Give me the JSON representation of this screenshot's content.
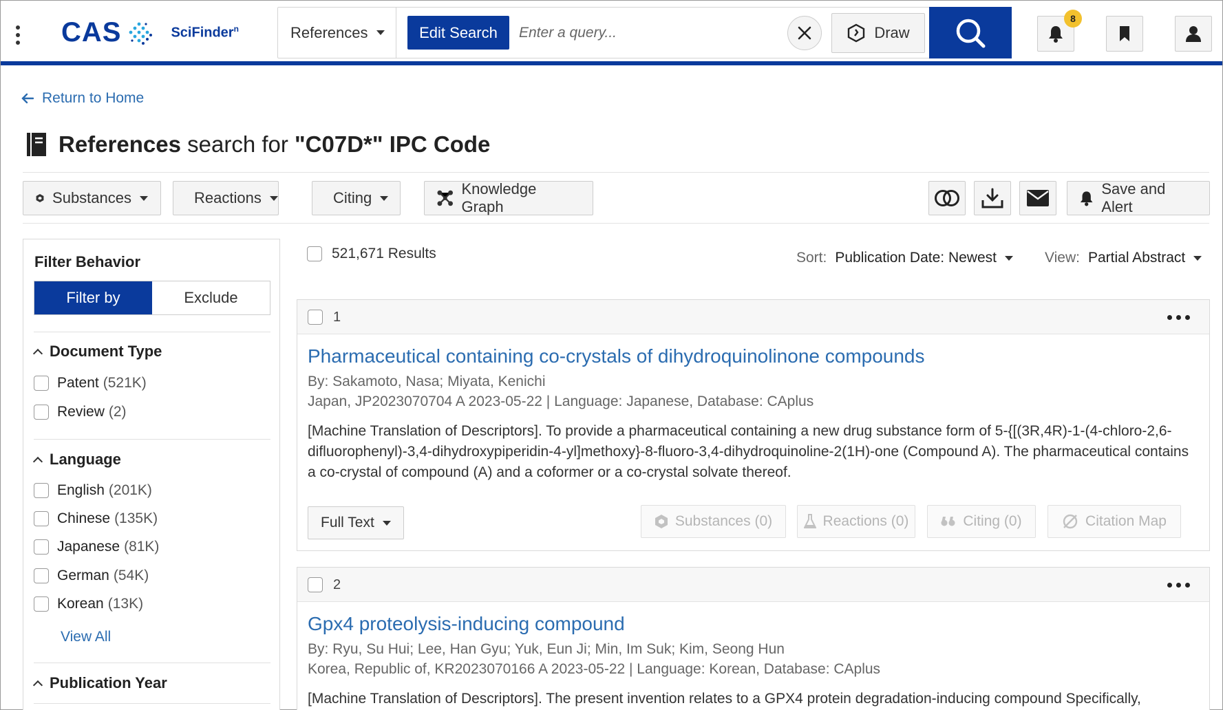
{
  "header": {
    "logo_text": "CAS",
    "product_name": "SciFinder",
    "product_sup": "n",
    "search_type": "References",
    "edit_search_label": "Edit Search",
    "query_placeholder": "Enter a query...",
    "draw_label": "Draw",
    "notification_count": "8",
    "brand_color": "#0a3a9c"
  },
  "nav": {
    "return_label": "Return to Home"
  },
  "page": {
    "title_bold": "References",
    "title_mid": " search for ",
    "title_query": "\"C07D*\" IPC Code"
  },
  "toolbar": {
    "substances": "Substances",
    "reactions": "Reactions",
    "citing": "Citing",
    "knowledge_graph": "Knowledge Graph",
    "save_alert": "Save and Alert"
  },
  "sidebar": {
    "filter_behavior": "Filter Behavior",
    "filter_by": "Filter by",
    "exclude": "Exclude",
    "doc_type_title": "Document Type",
    "doc_types": [
      {
        "label": "Patent",
        "count": "(521K)"
      },
      {
        "label": "Review",
        "count": "(2)"
      }
    ],
    "language_title": "Language",
    "languages": [
      {
        "label": "English",
        "count": "(201K)"
      },
      {
        "label": "Chinese",
        "count": "(135K)"
      },
      {
        "label": "Japanese",
        "count": "(81K)"
      },
      {
        "label": "German",
        "count": "(54K)"
      },
      {
        "label": "Korean",
        "count": "(13K)"
      }
    ],
    "view_all": "View All",
    "pub_year_title": "Publication Year"
  },
  "results": {
    "count_label": "521,671 Results",
    "sort_label": "Sort:",
    "sort_value": "Publication Date: Newest",
    "view_label": "View:",
    "view_value": "Partial Abstract",
    "items": [
      {
        "num": "1",
        "title": "Pharmaceutical containing co-crystals of dihydroquinolinone compounds",
        "authors": "By: Sakamoto, Nasa; Miyata, Kenichi",
        "source": "Japan, JP2023070704 A 2023-05-22 | Language: Japanese, Database: CAplus",
        "abstract": "[Machine Translation of Descriptors]. To provide a pharmaceutical containing a new drug substance form of 5-{[(3R,4R)-1-(4-chloro-2,6-difluorophenyl)-3,4-dihydroxypiperidin-4-yl]methoxy}-8-fluoro-3,4-dihydroquinoline-2(1H)-one (Compound A). The pharmaceutical contains a co-crystal of compound (A) and a coformer or a co-crystal solvate thereof.",
        "full_text": "Full Text",
        "substances": "Substances (0)",
        "reactions": "Reactions (0)",
        "citing": "Citing (0)",
        "citation_map": "Citation Map"
      },
      {
        "num": "2",
        "title": "Gpx4 proteolysis-inducing compound",
        "authors": "By: Ryu, Su Hui; Lee, Han Gyu; Yuk, Eun Ji; Min, Im Suk; Kim, Seong Hun",
        "source": "Korea, Republic of, KR2023070166 A 2023-05-22 | Language: Korean, Database: CAplus",
        "abstract": "[Machine Translation of Descriptors]. The present invention relates to a GPX4 protein degradation-inducing compound Specifically,"
      }
    ]
  }
}
